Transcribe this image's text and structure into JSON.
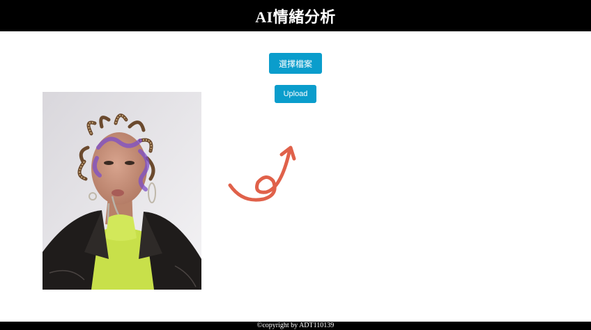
{
  "header": {
    "title": "AI情緒分析"
  },
  "controls": {
    "choose_file_label": "選擇檔案",
    "upload_label": "Upload"
  },
  "footer": {
    "copyright": "©copyright by ADT110139"
  },
  "colors": {
    "header_bg": "#000000",
    "button_bg": "#0a9dcc",
    "arrow": "#e0614a"
  },
  "icons": {
    "arrow": "curly-arrow-icon"
  }
}
